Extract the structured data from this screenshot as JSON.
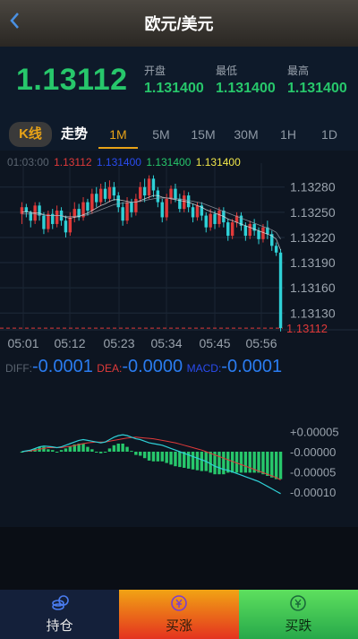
{
  "header": {
    "title": "欧元/美元"
  },
  "quote": {
    "price": "1.13112",
    "open_label": "开盘",
    "open_value": "1.131400",
    "low_label": "最低",
    "low_value": "1.131400",
    "high_label": "最高",
    "high_value": "1.131400"
  },
  "tabs": [
    {
      "label": "K线"
    },
    {
      "label": "走势"
    },
    {
      "label": "1M"
    },
    {
      "label": "5M"
    },
    {
      "label": "15M"
    },
    {
      "label": "30M"
    },
    {
      "label": "1H"
    },
    {
      "label": "1D"
    }
  ],
  "active_tab": "1M",
  "ma_legend": {
    "time": "01:03:00",
    "v1": "1.13112",
    "v2": "1.131400",
    "v3": "1.131400",
    "v4": "1.131400"
  },
  "macd_legend": {
    "diff_label": "DIFF:",
    "diff_value": "-0.0001",
    "dea_label": "DEA:",
    "dea_value": "-0.0000",
    "macd_label": "MACD:",
    "macd_value": "-0.0001"
  },
  "colors": {
    "up": "#e03a3a",
    "down": "#2fd0d6",
    "accent": "#e8a317",
    "green": "#27c76b"
  },
  "chart_data": {
    "type": "candlestick",
    "x_ticks": [
      "05:01",
      "05:12",
      "05:23",
      "05:34",
      "05:45",
      "05:56"
    ],
    "y_ticks": [
      "1.13280",
      "1.13250",
      "1.13220",
      "1.13190",
      "1.13160",
      "1.13130"
    ],
    "current_price_label": "1.13112",
    "ylim": [
      1.1311,
      1.133
    ],
    "candles": [
      [
        1.13248,
        1.13256,
        1.13236,
        1.13262
      ],
      [
        1.13256,
        1.1325,
        1.13244,
        1.1326
      ],
      [
        1.1325,
        1.1324,
        1.13232,
        1.13252
      ],
      [
        1.1324,
        1.13258,
        1.13236,
        1.13262
      ],
      [
        1.13258,
        1.13246,
        1.1324,
        1.13262
      ],
      [
        1.13246,
        1.1323,
        1.13224,
        1.1325
      ],
      [
        1.1323,
        1.13248,
        1.13226,
        1.13252
      ],
      [
        1.13248,
        1.13236,
        1.1323,
        1.13254
      ],
      [
        1.13236,
        1.13252,
        1.13232,
        1.13258
      ],
      [
        1.13252,
        1.1324,
        1.13234,
        1.13256
      ],
      [
        1.1324,
        1.13226,
        1.1322,
        1.13246
      ],
      [
        1.13226,
        1.13244,
        1.13222,
        1.1325
      ],
      [
        1.13244,
        1.13254,
        1.13238,
        1.13262
      ],
      [
        1.13254,
        1.13244,
        1.1324,
        1.1326
      ],
      [
        1.13244,
        1.13262,
        1.1324,
        1.13268
      ],
      [
        1.13262,
        1.13252,
        1.13246,
        1.13266
      ],
      [
        1.13252,
        1.13272,
        1.13248,
        1.13278
      ],
      [
        1.13272,
        1.13262,
        1.13256,
        1.1328
      ],
      [
        1.13262,
        1.13278,
        1.13258,
        1.13284
      ],
      [
        1.13278,
        1.13266,
        1.13262,
        1.13286
      ],
      [
        1.13266,
        1.1328,
        1.13262,
        1.13288
      ],
      [
        1.1328,
        1.1327,
        1.13264,
        1.13286
      ],
      [
        1.1327,
        1.13256,
        1.1325,
        1.13274
      ],
      [
        1.13256,
        1.1324,
        1.13234,
        1.13262
      ],
      [
        1.1324,
        1.13262,
        1.13236,
        1.13268
      ],
      [
        1.13262,
        1.1325,
        1.13244,
        1.13266
      ],
      [
        1.1325,
        1.13266,
        1.13246,
        1.13272
      ],
      [
        1.13266,
        1.1328,
        1.13262,
        1.13286
      ],
      [
        1.1328,
        1.1327,
        1.13262,
        1.1329
      ],
      [
        1.1327,
        1.1329,
        1.13266,
        1.13294
      ],
      [
        1.1329,
        1.13276,
        1.13268,
        1.13294
      ],
      [
        1.13276,
        1.13262,
        1.13256,
        1.1328
      ],
      [
        1.13262,
        1.13244,
        1.13238,
        1.13266
      ],
      [
        1.13244,
        1.13266,
        1.1324,
        1.13272
      ],
      [
        1.13266,
        1.13278,
        1.1326,
        1.13282
      ],
      [
        1.13278,
        1.13266,
        1.13262,
        1.13284
      ],
      [
        1.13266,
        1.13254,
        1.1325,
        1.13272
      ],
      [
        1.13254,
        1.1327,
        1.1325,
        1.13276
      ],
      [
        1.1327,
        1.13256,
        1.1325,
        1.13274
      ],
      [
        1.13256,
        1.13244,
        1.13238,
        1.1326
      ],
      [
        1.13244,
        1.13258,
        1.1324,
        1.13262
      ],
      [
        1.13258,
        1.13246,
        1.1324,
        1.13262
      ],
      [
        1.13246,
        1.13232,
        1.13226,
        1.1325
      ],
      [
        1.13232,
        1.13248,
        1.13228,
        1.13254
      ],
      [
        1.13248,
        1.13236,
        1.1323,
        1.13252
      ],
      [
        1.13236,
        1.13252,
        1.13232,
        1.13256
      ],
      [
        1.13252,
        1.13238,
        1.13232,
        1.13256
      ],
      [
        1.13238,
        1.13222,
        1.13216,
        1.13242
      ],
      [
        1.13222,
        1.13238,
        1.13218,
        1.13242
      ],
      [
        1.13238,
        1.13246,
        1.13232,
        1.1325
      ],
      [
        1.13246,
        1.13234,
        1.13228,
        1.1325
      ],
      [
        1.13234,
        1.13222,
        1.13216,
        1.13238
      ],
      [
        1.13222,
        1.13236,
        1.13218,
        1.1324
      ],
      [
        1.13236,
        1.13228,
        1.13222,
        1.13242
      ],
      [
        1.13228,
        1.13218,
        1.13212,
        1.13232
      ],
      [
        1.13218,
        1.13232,
        1.13214,
        1.13236
      ],
      [
        1.13232,
        1.13224,
        1.13218,
        1.1324
      ],
      [
        1.13224,
        1.1321,
        1.13204,
        1.13228
      ],
      [
        1.1321,
        1.13202,
        1.13198,
        1.13214
      ],
      [
        1.13202,
        1.13112,
        1.13108,
        1.13206
      ]
    ],
    "ma_lines": {
      "ma1": [
        1.1325,
        1.13251,
        1.1325,
        1.13249,
        1.13249,
        1.13247,
        1.13246,
        1.13246,
        1.13246,
        1.13246,
        1.13244,
        1.13243,
        1.13244,
        1.13245,
        1.13247,
        1.13249,
        1.13252,
        1.13255,
        1.13258,
        1.1326,
        1.13263,
        1.13265,
        1.13265,
        1.13264,
        1.13263,
        1.13262,
        1.13262,
        1.13264,
        1.13266,
        1.13268,
        1.1327,
        1.1327,
        1.13268,
        1.13267,
        1.13266,
        1.13265,
        1.13264,
        1.13263,
        1.13262,
        1.1326,
        1.13258,
        1.13256,
        1.13253,
        1.13251,
        1.13249,
        1.13247,
        1.13245,
        1.13242,
        1.1324,
        1.13238,
        1.13236,
        1.13234,
        1.13232,
        1.1323,
        1.13228,
        1.13226,
        1.13224,
        1.13222,
        1.13218,
        1.13205
      ],
      "ma2": [
        1.13248,
        1.13248,
        1.13248,
        1.13248,
        1.13247,
        1.13247,
        1.13246,
        1.13246,
        1.13246,
        1.13246,
        1.13245,
        1.13245,
        1.13245,
        1.13246,
        1.13246,
        1.13247,
        1.13249,
        1.13251,
        1.13253,
        1.13255,
        1.13257,
        1.13259,
        1.1326,
        1.13261,
        1.13261,
        1.13262,
        1.13262,
        1.13263,
        1.13264,
        1.13265,
        1.13266,
        1.13267,
        1.13267,
        1.13267,
        1.13267,
        1.13266,
        1.13266,
        1.13265,
        1.13264,
        1.13263,
        1.13262,
        1.13261,
        1.13259,
        1.13257,
        1.13255,
        1.13253,
        1.13251,
        1.13249,
        1.13247,
        1.13245,
        1.13243,
        1.13241,
        1.13239,
        1.13237,
        1.13235,
        1.13233,
        1.13231,
        1.13229,
        1.13226,
        1.13218
      ]
    },
    "macd": {
      "dif": [
        0,
        2e-06,
        4e-06,
        8e-06,
        1.2e-05,
        1.4e-05,
        1.3e-05,
        1.2e-05,
        1e-05,
        1.2e-05,
        1.6e-05,
        2e-05,
        2.4e-05,
        2.8e-05,
        3e-05,
        2.8e-05,
        2.6e-05,
        2.4e-05,
        2.2e-05,
        2.4e-05,
        3e-05,
        3.6e-05,
        4e-05,
        4.2e-05,
        4e-05,
        3.6e-05,
        3.2e-05,
        3e-05,
        2.6e-05,
        2.2e-05,
        2e-05,
        1.8e-05,
        1.6e-05,
        1.2e-05,
        8e-06,
        4e-06,
        0.0,
        -4e-06,
        -8e-06,
        -1.2e-05,
        -1.6e-05,
        -2e-05,
        -2.4e-05,
        -3e-05,
        -3.6e-05,
        -4e-05,
        -4.4e-05,
        -4.6e-05,
        -5e-05,
        -5.4e-05,
        -5.8e-05,
        -6.2e-05,
        -6.6e-05,
        -7e-05,
        -7.4e-05,
        -8e-05,
        -8.6e-05,
        -9.2e-05,
        -9.8e-05,
        -0.000104
      ],
      "dea": [
        0,
        1e-06,
        2e-06,
        4e-06,
        6e-06,
        8e-06,
        1e-05,
        1e-05,
        1e-05,
        1e-05,
        1.2e-05,
        1.3e-05,
        1.5e-05,
        1.8e-05,
        2e-05,
        2.2e-05,
        2.3e-05,
        2.4e-05,
        2.4e-05,
        2.4e-05,
        2.6e-05,
        2.8e-05,
        3e-05,
        3.2e-05,
        3.4e-05,
        3.5e-05,
        3.6e-05,
        3.5e-05,
        3.4e-05,
        3.3e-05,
        3.2e-05,
        3e-05,
        2.8e-05,
        2.6e-05,
        2.4e-05,
        2.2e-05,
        1.9e-05,
        1.6e-05,
        1.3e-05,
        1e-05,
        7e-06,
        4e-06,
        0.0,
        -4e-06,
        -8e-06,
        -1.2e-05,
        -1.6e-05,
        -2e-05,
        -2.4e-05,
        -2.8e-05,
        -3.2e-05,
        -3.6e-05,
        -4e-05,
        -4.4e-05,
        -4.8e-05,
        -5.2e-05,
        -5.6e-05,
        -6e-05,
        -6.4e-05,
        -7e-05
      ],
      "y_ticks": [
        "+0.00005",
        "-0.00000",
        "-0.00005",
        "-0.00010"
      ]
    }
  },
  "bottom": {
    "hold": "持仓",
    "buy_up": "买涨",
    "buy_down": "买跌"
  }
}
